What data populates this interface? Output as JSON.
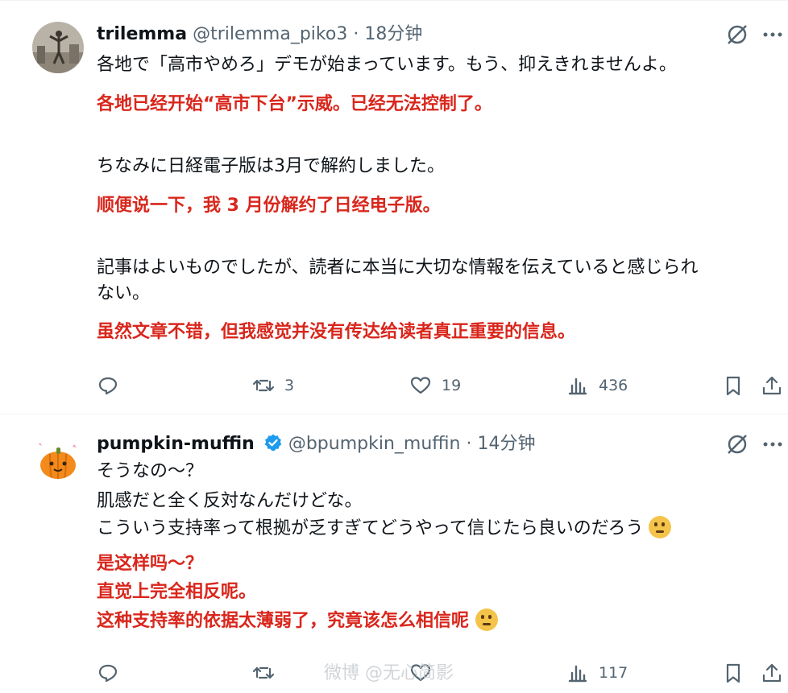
{
  "posts": [
    {
      "name": "trilemma",
      "handle": "@trilemma_piko3",
      "time": "18分钟",
      "lines": [
        {
          "text": "各地で「高市やめろ」デモが始まっています。もう、抑えきれませんよ。",
          "kind": "jp"
        },
        {
          "text": "各地已经开始“高市下台”示威。已经无法控制了。",
          "kind": "cn"
        },
        {
          "text": "ちなみに日経電子版は3月で解約しました。",
          "kind": "jp"
        },
        {
          "text": "顺便说一下，我 3 月份解约了日经电子版。",
          "kind": "cn"
        },
        {
          "text": "記事はよいものでしたが、読者に本当に大切な情報を伝えていると感じられ",
          "kind": "jp"
        },
        {
          "text": "ない。",
          "kind": "jp"
        },
        {
          "text": "虽然文章不错，但我感觉并没有传达给读者真正重要的信息。",
          "kind": "cn"
        }
      ],
      "stats": {
        "replies": "",
        "reposts": "3",
        "likes": "19",
        "views": "436"
      }
    },
    {
      "name": "pumpkin-muffin",
      "handle": "@bpumpkin_muffin",
      "time": "14分钟",
      "verified": true,
      "lines": [
        {
          "text": "そうなの〜？",
          "kind": "jp"
        },
        {
          "text": "肌感だと全く反対なんだけどな。",
          "kind": "jp"
        },
        {
          "text": "こういう支持率って根拠が乏すぎてどうやって信じたら良いのだろう",
          "kind": "jp"
        },
        {
          "text": "是这样吗～？",
          "kind": "cn"
        },
        {
          "text": "直觉上完全相反呢。",
          "kind": "cn"
        },
        {
          "text": "这种支持率的依据太薄弱了，究竟该怎么相信呢",
          "kind": "cn"
        }
      ],
      "emoji": "thinking-face",
      "stats": {
        "replies": "",
        "reposts": "",
        "likes": "",
        "views": "117"
      }
    }
  ],
  "separator": "·",
  "watermark": "微博 @无心简影",
  "colors": {
    "accent_red": "#d9261c",
    "muted": "#536471",
    "verified_blue": "#1d9bf0"
  }
}
